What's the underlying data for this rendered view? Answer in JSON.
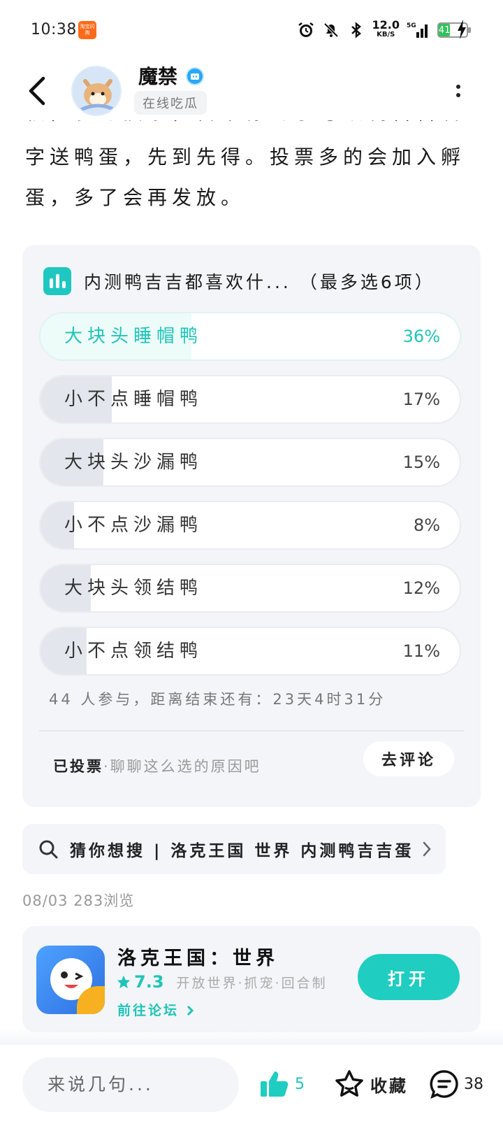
{
  "status_bar": {
    "time": "10:38",
    "notice_badge": "淘宝闪购",
    "net_speed": "12.0",
    "net_speed_unit": "KB/S",
    "signal": "5G",
    "battery": "41"
  },
  "header": {
    "username": "魔禁",
    "user_tag": "在线吃瓜"
  },
  "post": {
    "line_clipped": "积，参与投票，留下你的学号跟鸭吉吉名",
    "line_2": "字送鸭蛋，先到先得。投票多的会加入孵",
    "line_3": "蛋，多了会再发放。"
  },
  "vote": {
    "title": "内测鸭吉吉都喜欢什...",
    "limit": "（最多选6项）",
    "options": [
      {
        "label": "大块头睡帽鸭",
        "percent_text": "36%",
        "percent": 36,
        "selected": true
      },
      {
        "label": "小不点睡帽鸭",
        "percent_text": "17%",
        "percent": 17,
        "selected": false
      },
      {
        "label": "大块头沙漏鸭",
        "percent_text": "15%",
        "percent": 15,
        "selected": false
      },
      {
        "label": "小不点沙漏鸭",
        "percent_text": "8%",
        "percent": 8,
        "selected": false
      },
      {
        "label": "大块头领结鸭",
        "percent_text": "12%",
        "percent": 12,
        "selected": false
      },
      {
        "label": "小不点领结鸭",
        "percent_text": "11%",
        "percent": 11,
        "selected": false
      }
    ],
    "meta": "44 人参与，距离结束还有：23天4时31分",
    "voted_label": "已投票",
    "voted_hint": "·聊聊这么选的原因吧",
    "comment_button": "去评论"
  },
  "search_suggest": {
    "text": "猜你想搜 | 洛克王国 世界 内测鸭吉吉蛋"
  },
  "post_meta": "08/03  283浏览",
  "game": {
    "name": "洛克王国：世界",
    "score": "7.3",
    "tags": "开放世界·抓宠·回合制",
    "link": "前往论坛",
    "open_button": "打开"
  },
  "bottom_bar": {
    "input_placeholder": "来说几句...",
    "like_count": "5",
    "favorite_label": "收藏",
    "comment_count": "38"
  },
  "colors": {
    "accent": "#1fcdc1",
    "card_bg": "#f3f5f8",
    "option_fill": "#e3e7ed"
  }
}
